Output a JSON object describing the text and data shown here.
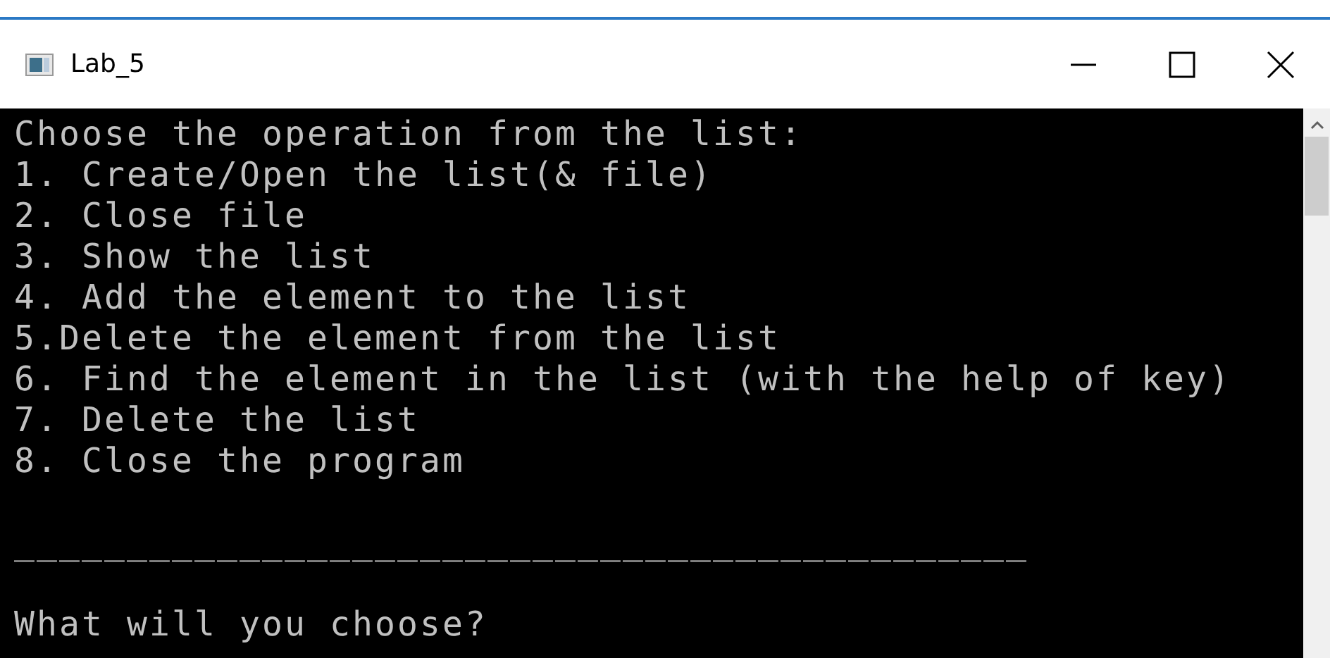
{
  "window": {
    "title": "Lab_5"
  },
  "console": {
    "lines": [
      "Choose the operation from the list:",
      "1. Create/Open the list(& file)",
      "2. Close file",
      "3. Show the list",
      "4. Add the element to the list",
      "5.Delete the element from the list",
      "6. Find the element in the list (with the help of key)",
      "7. Delete the list",
      "8. Close the program"
    ],
    "separator": "_____________________________________________",
    "prompt": "What will you choose?"
  }
}
